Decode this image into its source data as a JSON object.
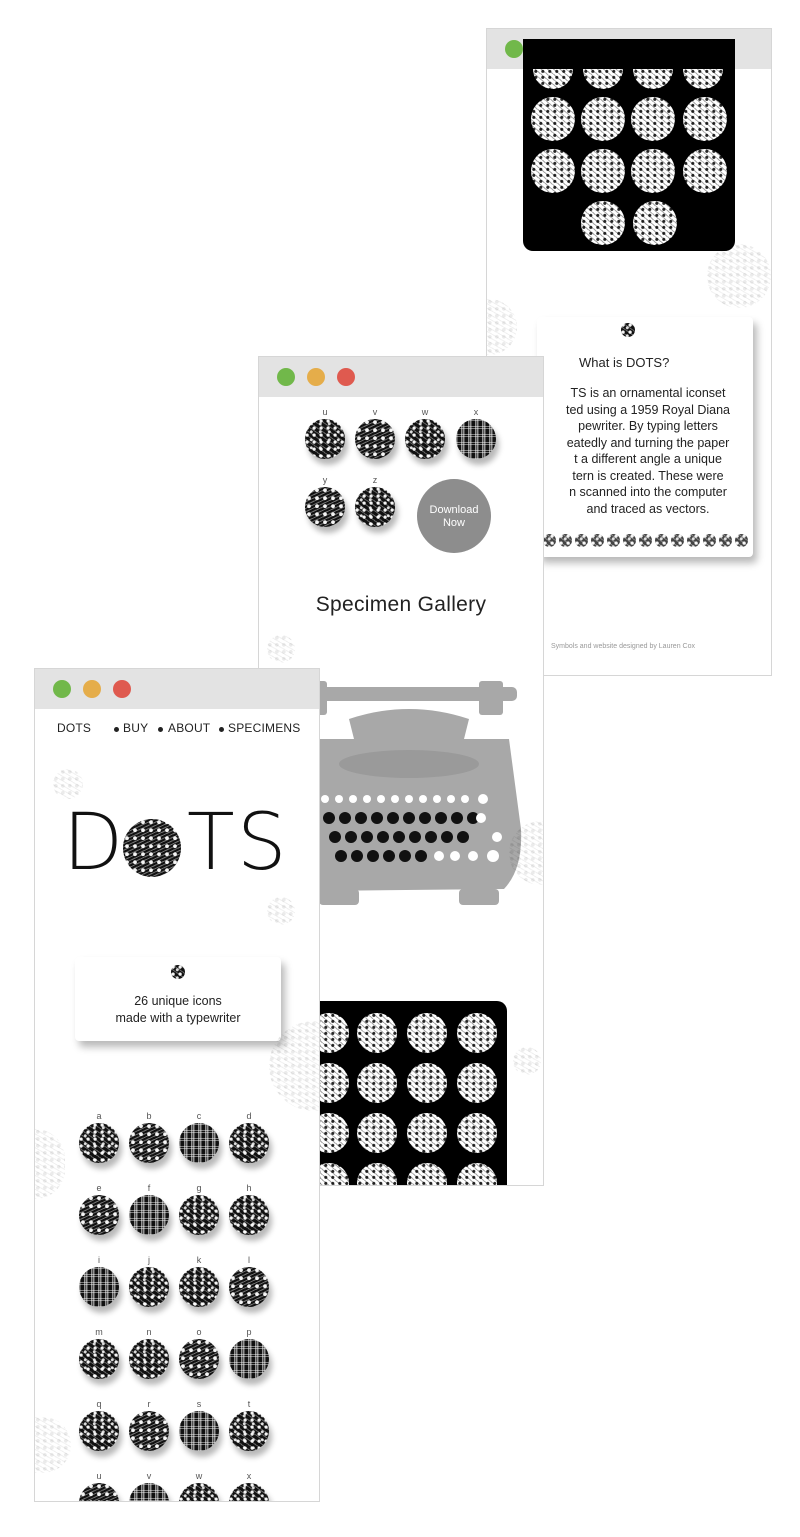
{
  "windows": {
    "home": {
      "nav": {
        "brand": "DOTS",
        "buy": "BUY",
        "about": "ABOUT",
        "specimens": "SPECIMENS"
      },
      "logo": {
        "letters": [
          "D",
          "T",
          "S"
        ],
        "dot_letter": "O"
      },
      "intro": {
        "line1": "26 unique icons",
        "line2": "made with a typewriter"
      },
      "icon_letters": [
        "a",
        "b",
        "c",
        "d",
        "e",
        "f",
        "g",
        "h",
        "i",
        "j",
        "k",
        "l",
        "m",
        "n",
        "o",
        "p",
        "q",
        "r",
        "s",
        "t",
        "u",
        "v",
        "w",
        "x"
      ]
    },
    "specimens": {
      "icon_letters": [
        "u",
        "v",
        "w",
        "x",
        "y",
        "z"
      ],
      "download": {
        "line1": "Download",
        "line2": "Now"
      },
      "gallery_title": "Specimen Gallery",
      "illustration": "typewriter-illustration"
    },
    "about": {
      "title": "What is DOTS?",
      "body": [
        "TS is an ornamental iconset",
        "ted using a 1959 Royal Diana",
        "pewriter. By typing letters",
        "eatedly and turning the paper",
        "t a different angle a unique",
        "tern is created. These were",
        "n scanned into the computer",
        "and traced as vectors."
      ],
      "credit": "Symbols and website designed by Lauren Cox"
    }
  },
  "colors": {
    "close": "#df5a4f",
    "minimize": "#e5ad4a",
    "maximize": "#71b84a",
    "titlebar": "#e3e3e3",
    "download": "#8d8d8d",
    "typewriter": "#a8a8a8"
  }
}
